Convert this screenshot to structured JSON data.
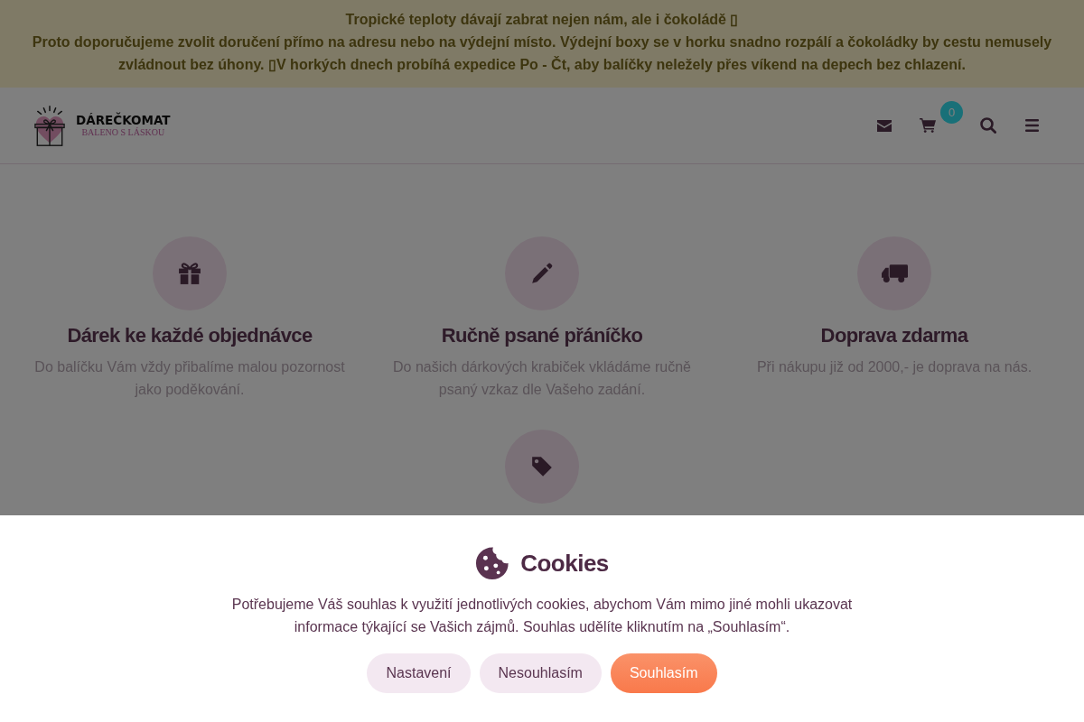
{
  "notice": {
    "title": "Tropické teploty dávají zabrat nejen nám, ale i čokoládě ▯",
    "text": "Proto doporučujeme zvolit doručení přímo na adresu nebo na výdejní místo. Výdejní boxy se v horku snadno rozpálí a čokoládky by cestu nemusely zvládnout bez úhony. ▯V horkých dnech probíhá expedice Po - Čt, aby balíčky neležely přes víkend na depech bez chlazení."
  },
  "header": {
    "logo": {
      "name": "DÁREČKOMAT",
      "tagline": "BALENO S LÁSKOU"
    },
    "cart_count": "0"
  },
  "features": [
    {
      "kind": "gift",
      "title": "Dárek ke každé objednávce",
      "text": "Do balíčku Vám vždy přibalíme malou pozornost jako poděkování."
    },
    {
      "kind": "pencil",
      "title": "Ručně psané přáníčko",
      "text": "Do našich dárkových krabiček vkládáme ručně psaný vzkaz dle Vašeho zadání."
    },
    {
      "kind": "truck",
      "title": "Doprava zdarma",
      "text": "Při nákupu již od 2000,- je doprava na nás."
    },
    {
      "kind": "tag"
    }
  ],
  "cookie_bar": {
    "title": "Cookies",
    "text": "Potřebujeme Váš souhlas k využití jednotlivých cookies, abychom Vám mimo jiné mohli ukazovat informace týkající se Vašich zájmů. Souhlas udělíte kliknutím na „Souhlasím“.",
    "buttons": [
      {
        "kind": "settings",
        "label": "Nastavení"
      },
      {
        "kind": "reject",
        "label": "Nesouhlasím"
      },
      {
        "kind": "accept",
        "label": "Souhlasím"
      }
    ]
  }
}
